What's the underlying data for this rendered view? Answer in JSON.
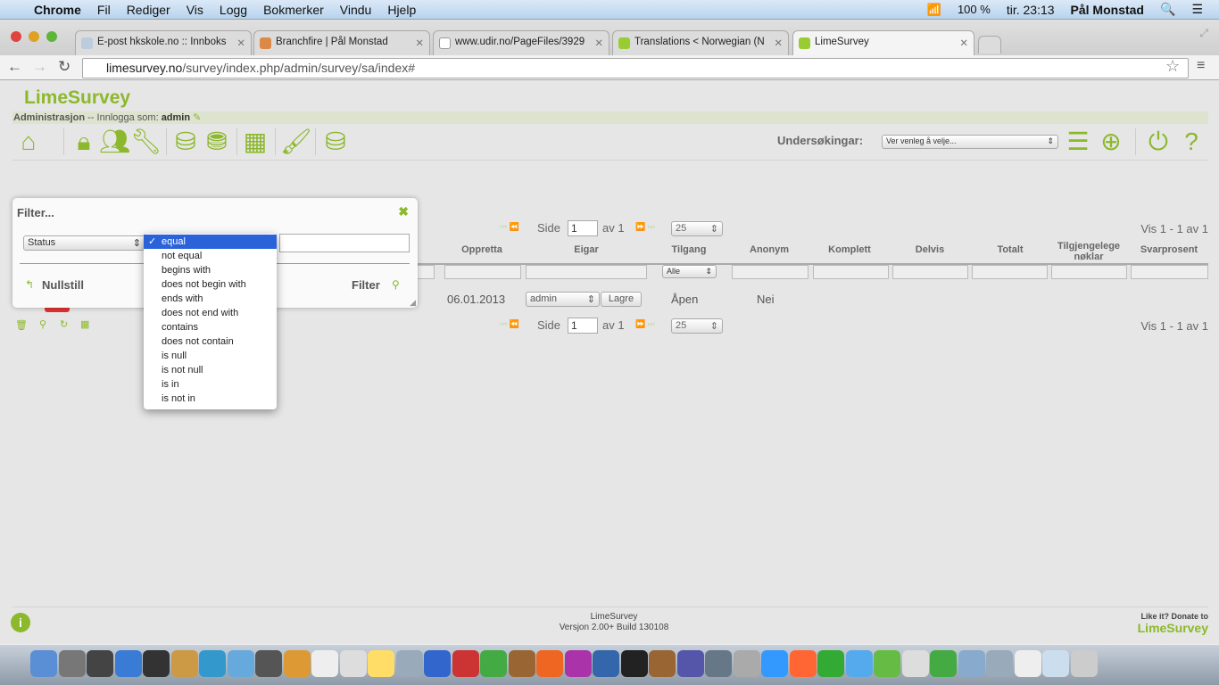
{
  "menubar": {
    "app": "Chrome",
    "items": [
      "Fil",
      "Rediger",
      "Vis",
      "Logg",
      "Bokmerker",
      "Vindu",
      "Hjelp"
    ],
    "battery": "100 %",
    "clock": "tir. 23:13",
    "user": "Pål Monstad"
  },
  "tabs": [
    {
      "label": "E-post hkskole.no :: Innboks"
    },
    {
      "label": "Branchfire | Pål Monstad"
    },
    {
      "label": "www.udir.no/PageFiles/3929"
    },
    {
      "label": "Translations < Norwegian (N"
    },
    {
      "label": "LimeSurvey",
      "active": true
    }
  ],
  "address": {
    "host": "limesurvey.no",
    "path": "/survey/index.php/admin/survey/sa/index#"
  },
  "app": {
    "logo": "LimeSurvey",
    "admin_label": "Administrasjon",
    "logged_in": "-- Innlogga som:",
    "user": "admin",
    "surveys_label": "Undersøkingar:",
    "surveys_select": "Ver venleg å velje...",
    "accent": "#8cb82b"
  },
  "grid": {
    "page_label": "Side",
    "page": "1",
    "of_label": "av 1",
    "page_size": "25",
    "showing": "Vis 1 - 1 av 1",
    "columns": [
      "Oppretta",
      "Eigar",
      "Tilgang",
      "Anonym",
      "Komplett",
      "Delvis",
      "Totalt",
      "Tilgjengelege nøklar",
      "Svarprosent"
    ],
    "access_filter": "Alle",
    "row": {
      "created": "06.01.2013",
      "owner": "admin",
      "save": "Lagre",
      "access": "Åpen",
      "anonymous": "Nei"
    }
  },
  "filter": {
    "title": "Filter...",
    "field": "Status",
    "value": "",
    "reset": "Nullstill",
    "apply": "Filter",
    "operators": [
      "equal",
      "not equal",
      "begins with",
      "does not begin with",
      "ends with",
      "does not end with",
      "contains",
      "does not contain",
      "is null",
      "is not null",
      "is in",
      "is not in"
    ],
    "selected": "equal"
  },
  "footer": {
    "name": "LimeSurvey",
    "version": "Versjon 2.00+ Build 130108",
    "donate": "Like it? Donate to",
    "donate_brand": "LimeSurvey"
  }
}
